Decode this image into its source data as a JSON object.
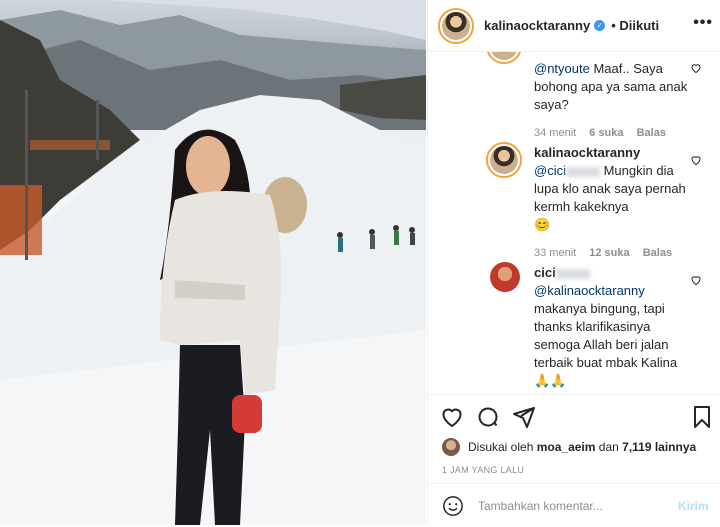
{
  "header": {
    "username": "kalinaocktaranny",
    "follow_label": "• Diikuti",
    "more_icon": "more-icon"
  },
  "comments": [
    {
      "author": "",
      "mention": "@ntyoute",
      "text": " Maaf.. Saya bohong apa ya sama anak saya?",
      "meta_time": "34 menit",
      "meta_likes": "6 suka",
      "meta_reply": "Balas"
    },
    {
      "author": "kalinaocktaranny",
      "mention": "@cici",
      "text": " Mungkin dia lupa klo anak saya pernah kermh kakeknya",
      "emoji": "😊",
      "meta_time": "33 menit",
      "meta_likes": "12 suka",
      "meta_reply": "Balas"
    },
    {
      "author": "cici",
      "mention": "@kalinaocktaranny",
      "text": " makanya bingung, tapi thanks klarifikasinya semoga Allah beri jalan terbaik buat mbak Kalina",
      "emoji": "🙏🙏"
    }
  ],
  "likes": {
    "prefix": "Disukai oleh",
    "user": "moa_aeim",
    "middle": "dan",
    "count": "7,119 lainnya"
  },
  "post_time": "1 JAM YANG LALU",
  "add_comment": {
    "placeholder": "Tambahkan komentar...",
    "post_label": "Kirim"
  },
  "colors": {
    "accent": "#3897f0",
    "link": "#00376b",
    "muted": "#8e8e8e"
  }
}
